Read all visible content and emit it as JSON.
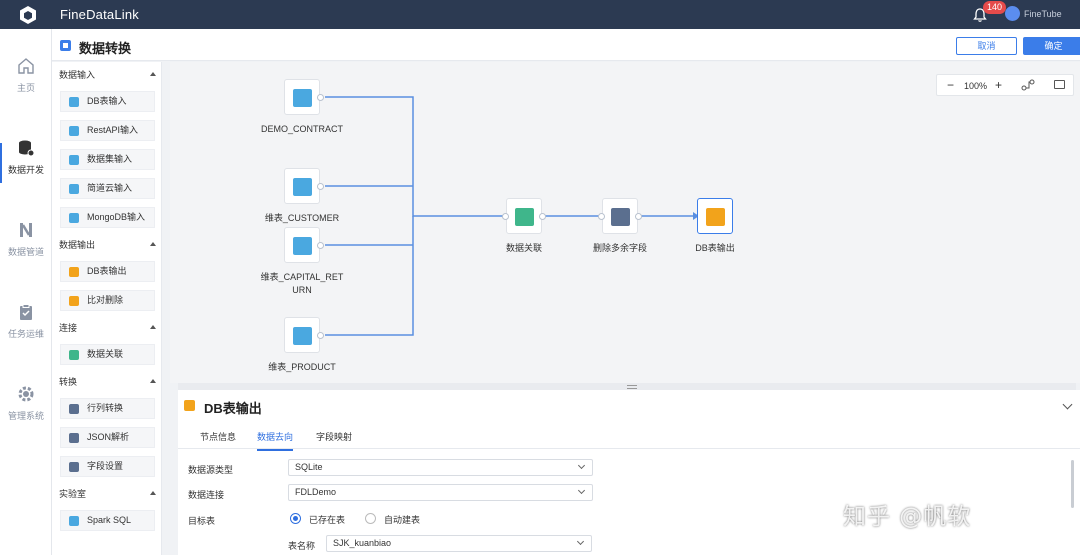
{
  "topbar": {
    "app_title": "FineDataLink",
    "notif_count": "140",
    "user": "FineTube"
  },
  "leftnav": [
    {
      "label": "主页",
      "icon": "home-icon"
    },
    {
      "label": "数据开发",
      "icon": "database-icon"
    },
    {
      "label": "数据管道",
      "icon": "pipeline-icon"
    },
    {
      "label": "任务运维",
      "icon": "clipboard-icon"
    },
    {
      "label": "管理系统",
      "icon": "gear-icon"
    }
  ],
  "header": {
    "title": "数据转换",
    "cancel": "取消",
    "ok": "确定"
  },
  "palette": {
    "sections": [
      {
        "title": "数据输入",
        "items": [
          "DB表输入",
          "RestAPI输入",
          "数据集输入",
          "简道云输入",
          "MongoDB输入"
        ]
      },
      {
        "title": "数据输出",
        "items": [
          "DB表输出",
          "比对删除"
        ]
      },
      {
        "title": "连接",
        "items": [
          "数据关联"
        ]
      },
      {
        "title": "转换",
        "items": [
          "行列转换",
          "JSON解析",
          "字段设置"
        ]
      },
      {
        "title": "实验室",
        "items": [
          "Spark SQL"
        ]
      }
    ]
  },
  "canvas": {
    "zoom": "100%",
    "nodes": [
      {
        "label": "DEMO_CONTRACT",
        "type": "DB"
      },
      {
        "label": "维表_CUSTOMER",
        "type": "DB"
      },
      {
        "label": "维表_CAPITAL_RETURN",
        "type": "DB"
      },
      {
        "label": "维表_PRODUCT",
        "type": "DB"
      },
      {
        "label": "数据关联",
        "type": "join"
      },
      {
        "label": "删除多余字段",
        "type": "fields"
      },
      {
        "label": "DB表输出",
        "type": "DB-output"
      }
    ]
  },
  "panel": {
    "title": "DB表输出",
    "tabs": [
      "节点信息",
      "数据去向",
      "字段映射"
    ],
    "active_tab": "数据去向",
    "fields": {
      "source_type_label": "数据源类型",
      "source_type_value": "SQLite",
      "connection_label": "数据连接",
      "connection_value": "FDLDemo",
      "target_label": "目标表",
      "radio_existing": "已存在表",
      "radio_auto": "自动建表",
      "table_name_label": "表名称",
      "table_name_value": "SJK_kuanbiao"
    }
  },
  "watermark": "知乎 @帆软",
  "colors": {
    "topbar": "#2c3a52",
    "accent": "#2f6fdf",
    "db_node": "#4aa8e0",
    "join_node": "#3fb68b",
    "output_node": "#f2a31b"
  }
}
